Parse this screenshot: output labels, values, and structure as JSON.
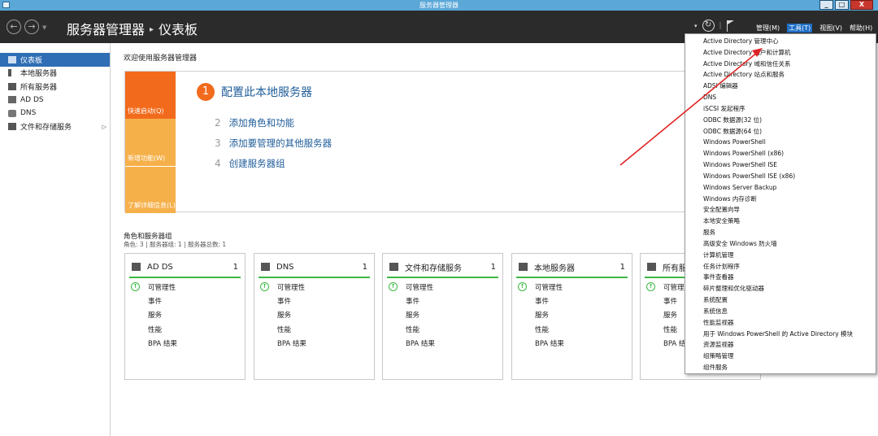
{
  "window": {
    "title": "服务器管理器",
    "buttons": [
      "_",
      "□",
      "X"
    ]
  },
  "header": {
    "back_glyph": "←",
    "forward_glyph": "→",
    "breadcrumb_root": "服务器管理器",
    "breadcrumb_sep": "▸",
    "breadcrumb_page": "仪表板",
    "refresh_glyph": "↻",
    "menus": [
      {
        "label": "管理(M)",
        "active": false
      },
      {
        "label": "工具(T)",
        "active": true
      },
      {
        "label": "视图(V)",
        "active": false
      },
      {
        "label": "帮助(H)",
        "active": false
      }
    ]
  },
  "sidebar": {
    "items": [
      {
        "label": "仪表板",
        "icon": "dashboard-icon",
        "active": true
      },
      {
        "label": "本地服务器",
        "icon": "server-icon"
      },
      {
        "label": "所有服务器",
        "icon": "servers-icon"
      },
      {
        "label": "AD DS",
        "icon": "adds-icon"
      },
      {
        "label": "DNS",
        "icon": "dns-icon"
      },
      {
        "label": "文件和存储服务",
        "icon": "storage-icon",
        "expand": "▷"
      }
    ]
  },
  "main": {
    "welcome": "欢迎使用服务器管理器",
    "quickstart": {
      "col1": "快速启动(Q)",
      "col2": "新增功能(W)",
      "col3": "了解详细信息(L)",
      "step1_num": "1",
      "step1": "配置此本地服务器",
      "steps": [
        {
          "num": "2",
          "label": "添加角色和功能"
        },
        {
          "num": "3",
          "label": "添加要管理的其他服务器"
        },
        {
          "num": "4",
          "label": "创建服务器组"
        }
      ]
    },
    "roles_title": "角色和服务器组",
    "roles_subtitle": "角色: 3 | 服务器组: 1 | 服务器总数: 1",
    "cards": [
      {
        "title": "AD DS",
        "count": "1",
        "icon": "adds-icon"
      },
      {
        "title": "DNS",
        "count": "1",
        "icon": "dns-icon"
      },
      {
        "title": "文件和存储服务",
        "count": "1",
        "icon": "storage-icon"
      },
      {
        "title": "本地服务器",
        "count": "1",
        "icon": "server-icon"
      },
      {
        "title": "所有服",
        "count": "",
        "icon": "servers-icon"
      }
    ],
    "card_rows": [
      "可管理性",
      "事件",
      "服务",
      "性能",
      "BPA 结果"
    ],
    "card_rows_cut": [
      "可管理",
      "事件",
      "服务",
      "性能",
      "BPA 结"
    ]
  },
  "tools_menu": {
    "items": [
      "Active Directory 管理中心",
      "Active Directory 用户和计算机",
      "Active Directory 域和信任关系",
      "Active Directory 站点和服务",
      "ADSI 编辑器",
      "DNS",
      "iSCSI 发起程序",
      "ODBC 数据源(32 位)",
      "ODBC 数据源(64 位)",
      "Windows PowerShell",
      "Windows PowerShell (x86)",
      "Windows PowerShell ISE",
      "Windows PowerShell ISE (x86)",
      "Windows Server Backup",
      "Windows 内存诊断",
      "安全配置向导",
      "本地安全策略",
      "服务",
      "高级安全 Windows 防火墙",
      "计算机管理",
      "任务计划程序",
      "事件查看器",
      "碎片整理和优化驱动器",
      "系统配置",
      "系统信息",
      "性能监视器",
      "用于 Windows PowerShell 的 Active Directory 模块",
      "资源监视器",
      "组策略管理",
      "组件服务"
    ]
  },
  "colors": {
    "accent": "#f26b1d",
    "link": "#1f5c99",
    "ok": "#3cb944",
    "annotation": "#e02424"
  }
}
